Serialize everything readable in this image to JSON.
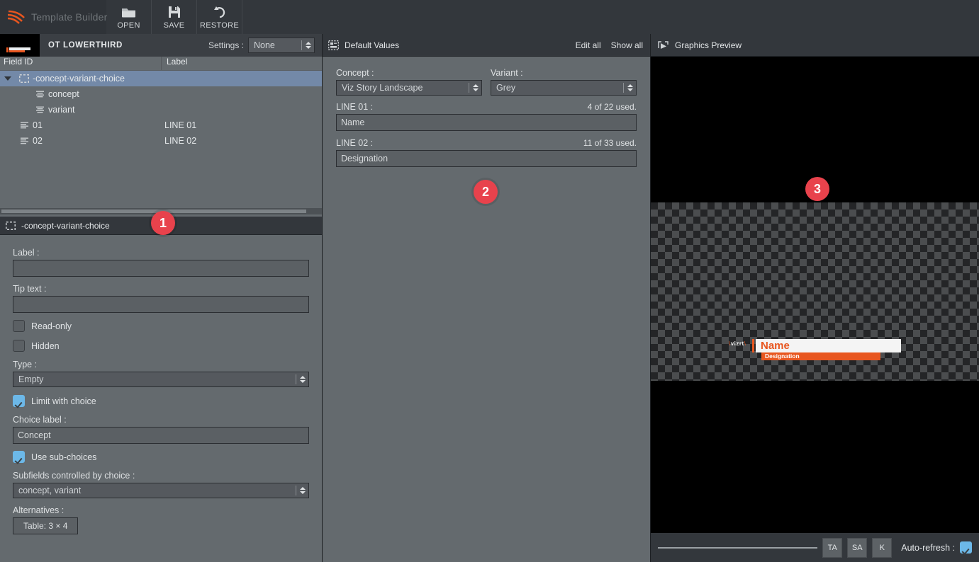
{
  "app": {
    "title": "Template Builder",
    "accent_orange": "#e8561f",
    "badge_red": "#e8424c",
    "panel_bg": "#646a6e",
    "header_bg": "#33373c"
  },
  "toolbar": {
    "buttons": [
      {
        "label": "OPEN",
        "icon": "folder-open-icon"
      },
      {
        "label": "SAVE",
        "icon": "floppy-disk-icon"
      },
      {
        "label": "RESTORE",
        "icon": "undo-arrow-icon"
      }
    ]
  },
  "template_strip": {
    "name": "OT LOWERTHIRD",
    "settings_label": "Settings :",
    "settings_value": "None",
    "settings_options": [
      "None"
    ]
  },
  "tree": {
    "columns": [
      "Field ID",
      "Label"
    ],
    "rows": [
      {
        "field_id": "-concept-variant-choice",
        "label": "",
        "depth": 0,
        "selected": true,
        "expanded": true,
        "icon": "empty-field-icon"
      },
      {
        "field_id": "concept",
        "label": "",
        "depth": 2,
        "selected": false,
        "icon": "text-lines-icon"
      },
      {
        "field_id": "variant",
        "label": "",
        "depth": 2,
        "selected": false,
        "icon": "text-lines-icon"
      },
      {
        "field_id": "01",
        "label": "LINE 01",
        "depth": 1,
        "selected": false,
        "icon": "text-lines-icon"
      },
      {
        "field_id": "02",
        "label": "LINE 02",
        "depth": 1,
        "selected": false,
        "icon": "text-lines-icon"
      }
    ]
  },
  "properties": {
    "header_title": "-concept-variant-choice",
    "header_icon": "empty-field-icon",
    "label_caption": "Label :",
    "label_value": "",
    "tip_caption": "Tip text :",
    "tip_value": "",
    "readonly_label": "Read-only",
    "readonly_checked": false,
    "hidden_label": "Hidden",
    "hidden_checked": false,
    "type_caption": "Type :",
    "type_value": "Empty",
    "limit_with_choice_label": "Limit with choice",
    "limit_with_choice_checked": true,
    "choice_label_caption": "Choice label :",
    "choice_label_value": "Concept",
    "use_subchoices_label": "Use sub-choices",
    "use_subchoices_checked": true,
    "subfields_caption": "Subfields controlled by choice :",
    "subfields_value": "concept, variant",
    "alternatives_caption": "Alternatives :",
    "alternatives_button": "Table: 3 × 4"
  },
  "default_values": {
    "header_title": "Default Values",
    "header_icon": "form-fields-icon",
    "edit_all": "Edit all",
    "show_all": "Show all",
    "concept_caption": "Concept :",
    "concept_value": "Viz Story Landscape",
    "variant_caption": "Variant :",
    "variant_value": "Grey",
    "line01_caption": "LINE 01 :",
    "line01_used": "4 of 22 used.",
    "line01_value": "Name",
    "line02_caption": "LINE 02 :",
    "line02_used": "11 of 33 used.",
    "line02_value": "Designation"
  },
  "graphics_preview": {
    "header_title": "Graphics Preview",
    "header_icon": "play-preview-icon",
    "buttons": [
      {
        "label": "TA",
        "name": "take-animation-button"
      },
      {
        "label": "SA",
        "name": "stop-animation-button"
      },
      {
        "label": "K",
        "name": "continue-key-button"
      }
    ],
    "auto_refresh_label": "Auto-refresh :",
    "auto_refresh_checked": true,
    "overlay": {
      "brand": "vizrt",
      "line01": "Name",
      "line02": "Designation",
      "name_bg": "#f4f4f4",
      "name_color": "#e8561f",
      "desig_bg": "#e8561f",
      "desig_color": "#ffffff"
    }
  },
  "badges": [
    {
      "number": "1",
      "panel": "field-tree-panel"
    },
    {
      "number": "2",
      "panel": "default-values-panel"
    },
    {
      "number": "3",
      "panel": "graphics-preview-panel"
    }
  ]
}
